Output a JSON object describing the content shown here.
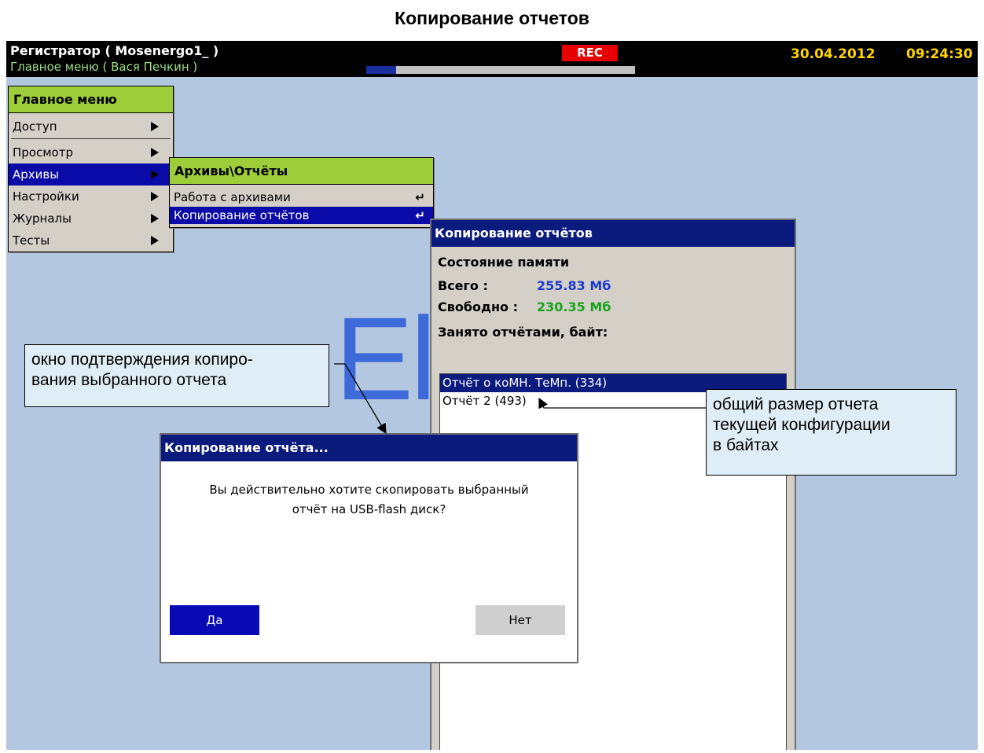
{
  "page_title": "Копирование отчетов",
  "header": {
    "title": "Регистратор ( Mosenergo1_ )",
    "subtitle": "Главное меню ( Вася Печкин )",
    "rec": "REC",
    "progress_fraction": 0.11,
    "date": "30.04.2012",
    "time": "09:24:30"
  },
  "main_menu": {
    "title": "Главное меню",
    "items": [
      "Доступ",
      "Просмотр",
      "Архивы",
      "Настройки",
      "Журналы",
      "Тесты"
    ]
  },
  "sub_menu": {
    "title": "Архивы\\Отчёты",
    "items": [
      "Работа с архивами",
      "Копирование отчётов"
    ]
  },
  "watermark": "El",
  "reports_window": {
    "title": "Копирование отчётов",
    "memory_state": "Состояние памяти",
    "total_label": "Всего :",
    "total_value": "255.83 Мб",
    "free_label": "Свободно :",
    "free_value": "230.35 Мб",
    "used_label": "Занято отчётами, байт:",
    "reports": [
      "Отчёт о коМН. ТеМп. (334)",
      "Отчёт 2 (493)"
    ]
  },
  "dialog": {
    "title": "Копирование отчёта...",
    "line1": "Вы действительно хотите скопировать выбранный",
    "line2": "отчёт на USB-flash диск?",
    "yes": "Да",
    "no": "Нет"
  },
  "callouts": {
    "left_line1": "окно подтверждения копиро-",
    "left_line2": "вания выбранного отчета",
    "right_line1": "общий размер отчета",
    "right_line2": "текущей конфигурации",
    "right_line3": "в байтах"
  }
}
